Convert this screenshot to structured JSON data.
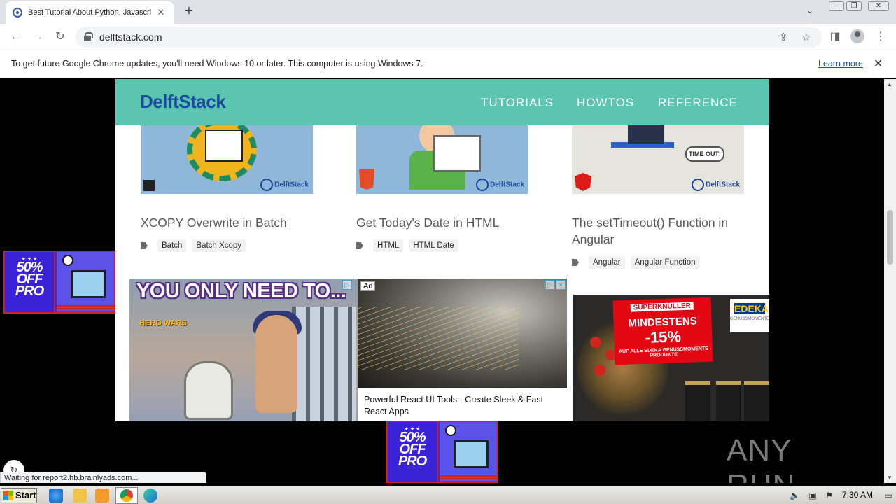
{
  "browser": {
    "tab_title": "Best Tutorial About Python, Javascript",
    "tab_close": "✕",
    "new_tab": "+",
    "url": "delftstack.com",
    "window_controls": [
      "minimize",
      "restore",
      "close"
    ]
  },
  "infobar": {
    "message": "To get future Google Chrome updates, you'll need Windows 10 or later. This computer is using Windows 7.",
    "link": "Learn more",
    "close": "✕"
  },
  "site": {
    "logo": "DelftStack",
    "nav": [
      "TUTORIALS",
      "HOWTOS",
      "REFERENCE"
    ],
    "thumb_brand": "DelftStack",
    "thumb3_text": "TIME OUT!",
    "posts": [
      {
        "title": "XCOPY Overwrite in Batch",
        "tags": [
          "Batch",
          "Batch Xcopy"
        ]
      },
      {
        "title": "Get Today's Date in HTML",
        "tags": [
          "HTML",
          "HTML Date"
        ]
      },
      {
        "title": "The setTimeout() Function in Angular",
        "tags": [
          "Angular",
          "Angular Function"
        ]
      }
    ]
  },
  "ads": {
    "hero": {
      "headline": "YOU ONLY NEED TO...",
      "game": "HERO WARS"
    },
    "react": {
      "badge": "Ad",
      "caption": "Powerful React UI Tools - Create Sleek & Fast React Apps"
    },
    "edeka": {
      "tag": "SUPERKNÜLLER",
      "title": "MINDESTENS",
      "discount": "-15%",
      "subtitle": "AUF ALLE EDEKA GENUSSMOMENTE PRODUKTE",
      "brand": "EDEKA",
      "brand_sub": "GENUSSMOMENTE"
    },
    "promo": {
      "discount": "50%",
      "off": "OFF",
      "product": "PRO"
    }
  },
  "status": {
    "text": "Waiting for report2.hb.brainlyads.com..."
  },
  "watermark": {
    "text": "ANY RUN"
  },
  "taskbar": {
    "start": "Start",
    "time": "7:30 AM"
  },
  "colors": {
    "header_bg": "#5bc5b0",
    "logo": "#1c4a9c",
    "promo_blue": "#3a22d8",
    "promo_red": "#d0201f"
  }
}
